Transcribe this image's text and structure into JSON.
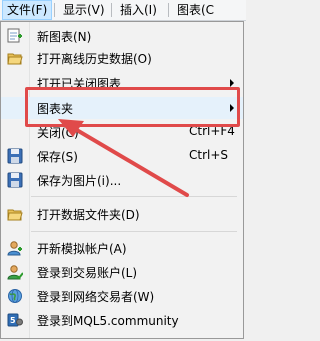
{
  "menubar": {
    "items": [
      {
        "label": "文件(F)"
      },
      {
        "label": "显示(V)"
      },
      {
        "label": "插入(I)"
      },
      {
        "label": "图表(C"
      }
    ]
  },
  "menu": {
    "new_chart": "新图表(N)",
    "open_offline": "打开离线历史数据(O)",
    "open_deleted": "打开已关闭图表",
    "chart_folder": "图表夹",
    "close_label": "关闭(C)",
    "close_shortcut": "Ctrl+F4",
    "save_label": "保存(S)",
    "save_shortcut": "Ctrl+S",
    "save_as_picture": "保存为图片(i)...",
    "open_data_folder": "打开数据文件夹(D)",
    "open_account": "开新模拟帐户(A)",
    "login_trade": "登录到交易账户(L)",
    "login_web": "登录到网络交易者(W)",
    "login_community": "登录到MQL5.community"
  },
  "colors": {
    "annotation": "#e04a4a",
    "menu_highlight": "#e5f1fb",
    "menubar_active": "#cce8ff"
  },
  "icons": [
    "new-chart-icon",
    "open-folder-icon",
    "save-disk-icon",
    "account-user-icon",
    "login-user-icon",
    "web-globe-icon",
    "mql5-icon"
  ]
}
